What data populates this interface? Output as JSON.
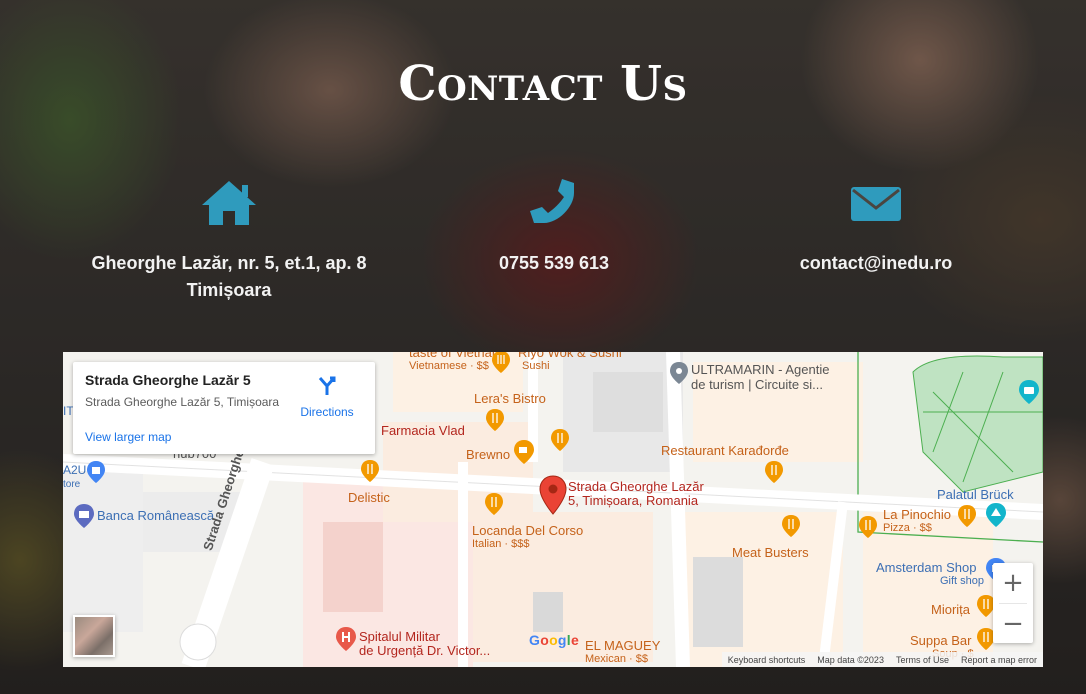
{
  "header": {
    "title": "Contact Us"
  },
  "contacts": {
    "address_line1": "Gheorghe Lazăr, nr. 5, et.1, ap. 8",
    "address_line2": "Timișoara",
    "phone": "0755 539 613",
    "email": "contact@inedu.ro",
    "icon_color": "#2f9bbd"
  },
  "map": {
    "card": {
      "title": "Strada Gheorghe Lazăr 5",
      "subtitle": "Strada Gheorghe Lazăr 5, Timișoara",
      "directions": "Directions",
      "larger_map": "View larger map"
    },
    "marker_label_1": "Strada Gheorghe Lazăr",
    "marker_label_2": "5, Timișoara, Romania",
    "pois": {
      "top_cut_1": "taste of Vietnam",
      "top_cut_1_sub": "Vietnamese · $$",
      "riyo": "Riyo Wok & Sushi",
      "riyo_sub": "Sushi",
      "ultramarin_1": "ULTRAMARIN - Agentie",
      "ultramarin_2": "de turism | Circuite si...",
      "leras": "Lera's Bistro",
      "farmacia": "Farmacia Vlad",
      "brewno": "Brewno",
      "hub": "hub700",
      "karadjordje": "Restaurant Karađorđe",
      "delistic": "Delistic",
      "locanda": "Locanda Del Corso",
      "locanda_sub": "Italian · $$$",
      "banca": "Banca Românească",
      "meat": "Meat Busters",
      "palatul": "Palatul Brück",
      "lapinochio": "La Pinochio",
      "lapinochio_sub": "Pizza · $$",
      "amsterdam": "Amsterdam Shop",
      "amsterdam_sub": "Gift shop",
      "miorita": "Miorița",
      "suppa": "Suppa Bar",
      "suppa_sub": "Soup · $",
      "spitalul_1": "Spitalul Militar",
      "spitalul_2": "de Urgență Dr. Victor...",
      "elmaguey": "EL MAGUEY",
      "elmaguey_sub": "Mexican · $$",
      "street": "Strada Gheorghe Dima",
      "left_cut_1": "IT",
      "left_cut_2": "A2U",
      "left_cut_3": "tore"
    },
    "google_logo": "Google",
    "footer": {
      "shortcuts": "Keyboard shortcuts",
      "mapdata": "Map data ©2023",
      "terms": "Terms of Use",
      "report": "Report a map error"
    },
    "zoom_in": "+",
    "zoom_out": "−"
  }
}
